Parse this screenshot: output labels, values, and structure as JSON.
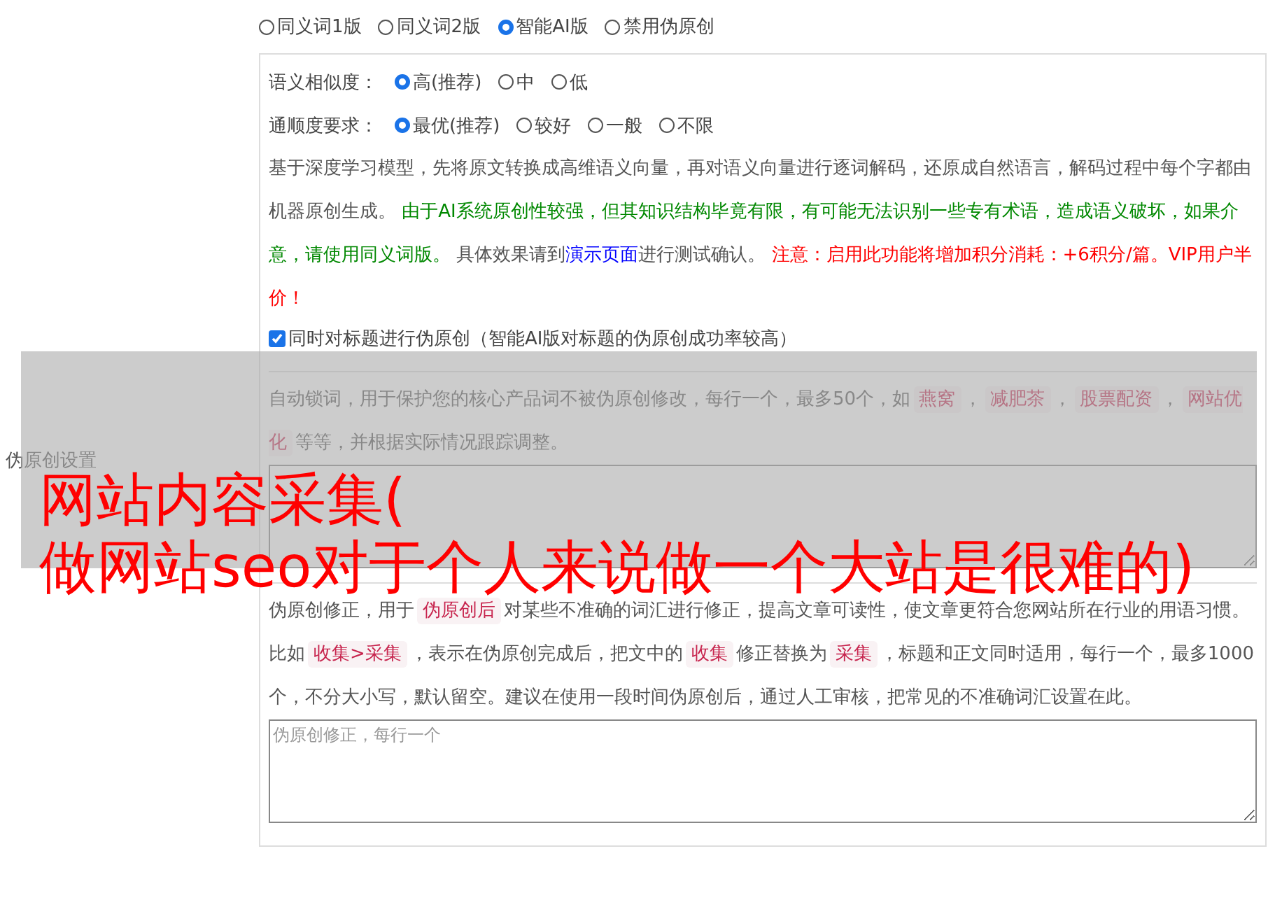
{
  "side_label": "伪原创设置",
  "modes": [
    {
      "label": "同义词1版",
      "selected": false
    },
    {
      "label": "同义词2版",
      "selected": false
    },
    {
      "label": "智能AI版",
      "selected": true
    },
    {
      "label": "禁用伪原创",
      "selected": false
    }
  ],
  "similarity": {
    "label": "语义相似度：",
    "options": [
      {
        "label": "高(推荐)",
        "selected": true
      },
      {
        "label": "中",
        "selected": false
      },
      {
        "label": "低",
        "selected": false
      }
    ]
  },
  "fluency": {
    "label": "通顺度要求：",
    "options": [
      {
        "label": "最优(推荐)",
        "selected": true
      },
      {
        "label": "较好",
        "selected": false
      },
      {
        "label": "一般",
        "selected": false
      },
      {
        "label": "不限",
        "selected": false
      }
    ]
  },
  "ai_description": [
    {
      "kind": "plain",
      "text": "基于深度学习模型，先将原文转换成高维语义向量，再对语义向量进行逐词解码，还原成自然语言，解码过程中每个字都由机器原创生成。 "
    },
    {
      "kind": "green",
      "text": "由于AI系统原创性较强，但其知识结构毕竟有限，有可能无法识别一些专有术语，造成语义破坏，如果介意，请使用同义词版。"
    },
    {
      "kind": "plain",
      "text": " 具体效果请到"
    },
    {
      "kind": "link",
      "text": "演示页面"
    },
    {
      "kind": "plain",
      "text": "进行测试确认。 "
    },
    {
      "kind": "red",
      "text": "注意：启用此功能将增加积分消耗：+6积分/篇。VIP用户半价！"
    }
  ],
  "title_option": {
    "label": "同时对标题进行伪原创（智能AI版对标题的伪原创成功率较高）",
    "checked": true
  },
  "lock_words": {
    "description": [
      {
        "kind": "plain",
        "text": "自动锁词，用于保护您的核心产品词不被伪原创修改，每行一个，最多50个，如"
      },
      {
        "kind": "code",
        "text": "燕窝"
      },
      {
        "kind": "plain",
        "text": "，"
      },
      {
        "kind": "code",
        "text": "减肥茶"
      },
      {
        "kind": "plain",
        "text": "，"
      },
      {
        "kind": "code",
        "text": "股票配资"
      },
      {
        "kind": "plain",
        "text": "，"
      },
      {
        "kind": "code",
        "text": "网站优化"
      },
      {
        "kind": "plain",
        "text": "等等，并根据实际情况跟踪调整。"
      }
    ]
  },
  "corrections": {
    "description": [
      {
        "kind": "plain",
        "text": "伪原创修正，用于"
      },
      {
        "kind": "code",
        "text": "伪原创后"
      },
      {
        "kind": "plain",
        "text": "对某些不准确的词汇进行修正，提高文章可读性，使文章更符合您网站所在行业的用语习惯。比如"
      },
      {
        "kind": "code",
        "text": "收集>采集"
      },
      {
        "kind": "plain",
        "text": "，表示在伪原创完成后，把文中的"
      },
      {
        "kind": "code",
        "text": "收集"
      },
      {
        "kind": "plain",
        "text": "修正替换为"
      },
      {
        "kind": "code",
        "text": "采集"
      },
      {
        "kind": "plain",
        "text": "，标题和正文同时适用，每行一个，最多1000个，不分大小写，默认留空。建议在使用一段时间伪原创后，通过人工审核，把常见的不准确词汇设置在此。"
      }
    ],
    "placeholder": "伪原创修正，每行一个"
  },
  "overlay": {
    "caption_lines": [
      "网站内容采集(",
      "做网站seo对于个人来说做一个大站是很难的)"
    ]
  }
}
